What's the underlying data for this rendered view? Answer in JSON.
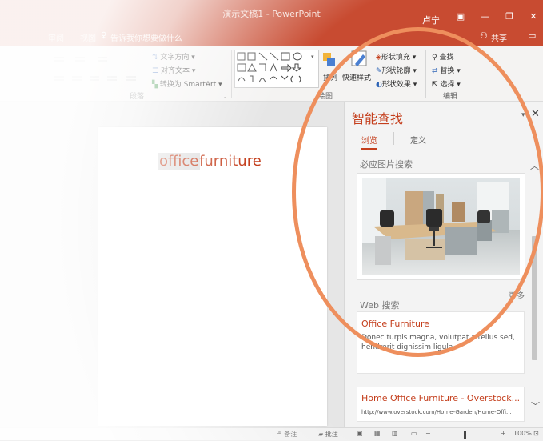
{
  "window": {
    "title": "演示文稿1 - PowerPoint",
    "user": "卢宁",
    "controls": [
      "minimize",
      "restore",
      "close"
    ]
  },
  "tellbar": {
    "tabs": [
      "审阅",
      "视图"
    ],
    "tell_me": "告诉我你想要做什么",
    "share": "共享"
  },
  "ribbon": {
    "paragraph": {
      "text_direction": "文字方向 ▾",
      "align_text": "对齐文本 ▾",
      "smartart": "转换为 SmartArt ▾",
      "group_label": "段落"
    },
    "drawing": {
      "arrange": "排列",
      "quick_styles": "快速样式",
      "shape_fill": "形状填充 ▾",
      "shape_outline": "形状轮廓 ▾",
      "shape_effects": "形状效果 ▾",
      "group_label": "绘图"
    },
    "editing": {
      "find": "查找",
      "replace": "替换 ▾",
      "select": "选择 ▾",
      "group_label": "编辑"
    }
  },
  "slide": {
    "highlighted_word": "office",
    "rest_text": "furniture"
  },
  "smart_lookup": {
    "title": "智能查找",
    "tabs": [
      "浏览",
      "定义"
    ],
    "active_tab": "浏览",
    "bing_section": "必应图片搜索",
    "more": "更多",
    "web_section": "Web 搜索",
    "results": [
      {
        "title": "Office Furniture",
        "snippet": "Donec turpis magna, volutpat a tellus sed, hendrerit dignissim ligula."
      },
      {
        "title": "Home Office Furniture - Overstock...",
        "url": "http://www.overstock.com/Home-Garden/Home-Offi..."
      }
    ]
  },
  "status": {
    "notes": "备注",
    "comments": "批注",
    "zoom": "100%"
  },
  "colors": {
    "accent": "#c43e1c",
    "titlebar": "#c84b31",
    "highlight_circle": "#ee8f5d"
  }
}
